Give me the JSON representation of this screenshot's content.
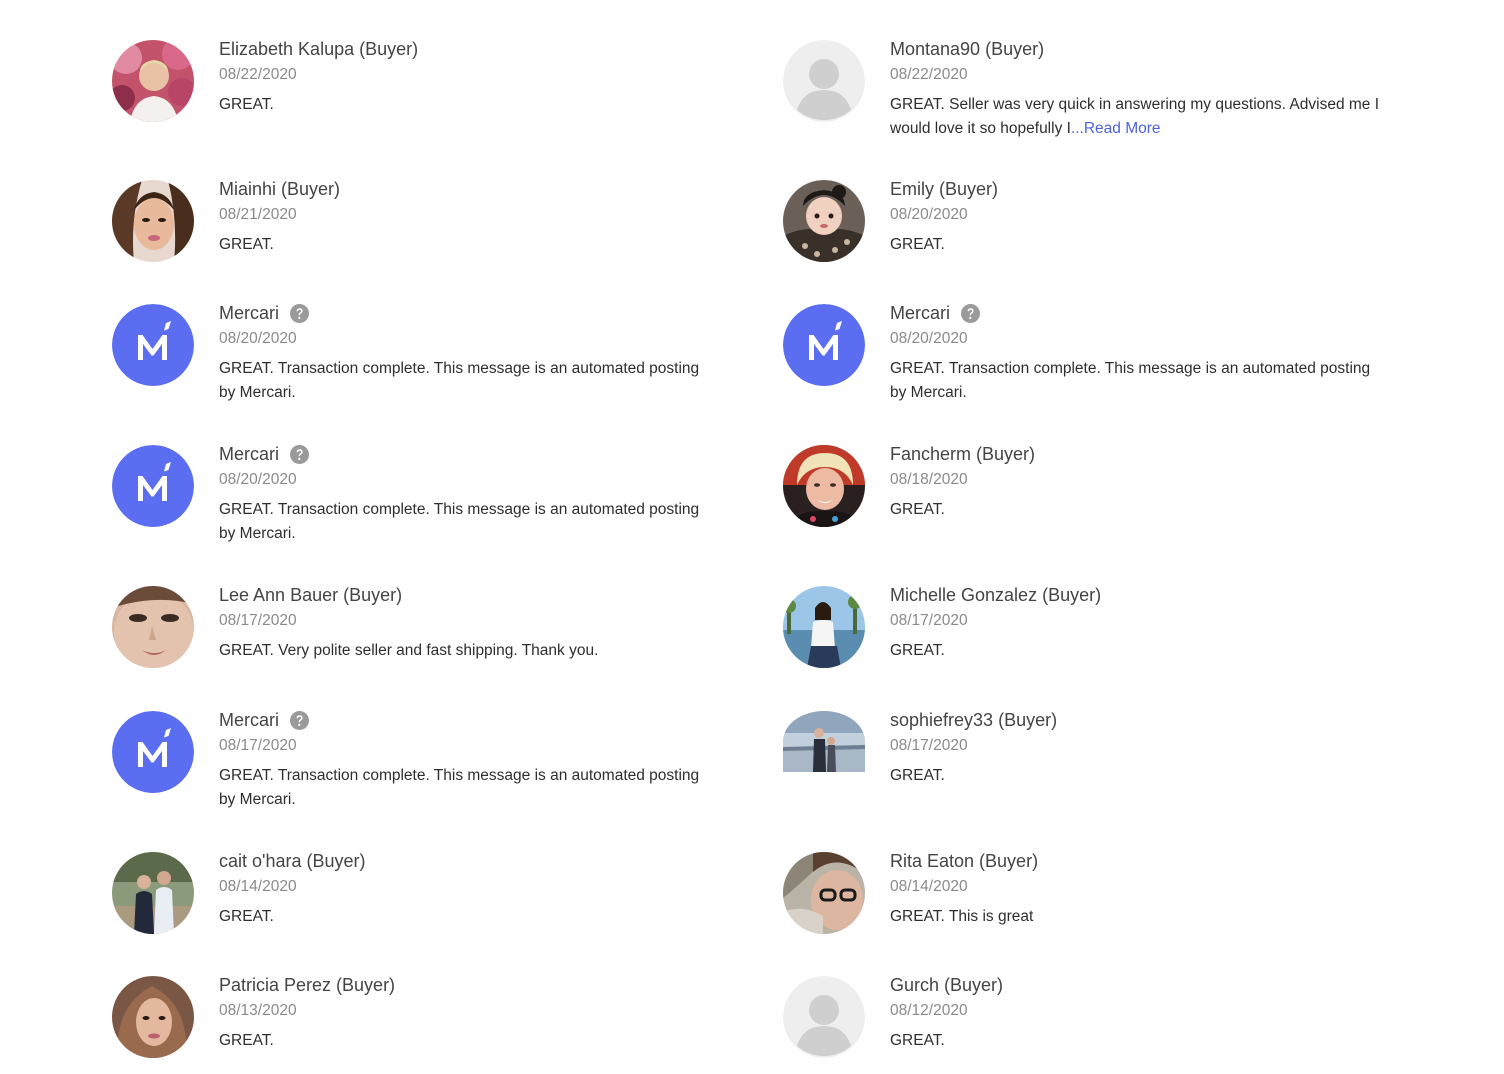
{
  "colors": {
    "mercari_brand": "#5b6df0",
    "link": "#4f63d9",
    "date_gray": "#8a8a8a",
    "placeholder_bg": "#eeeeee",
    "placeholder_fg": "#cfcfcf"
  },
  "reviews": [
    {
      "name": "Elizabeth Kalupa (Buyer)",
      "date": "08/22/2020",
      "text": "GREAT.",
      "avatar": "photo"
    },
    {
      "name": "Montana90 (Buyer)",
      "date": "08/22/2020",
      "text": "GREAT. Seller was very quick in answering my questions. Advised me I would love it so hopefully I",
      "ellipsis": "...",
      "read_more": "Read More",
      "avatar": "person-placeholder-icon"
    },
    {
      "name": "Miainhi (Buyer)",
      "date": "08/21/2020",
      "text": "GREAT.",
      "avatar": "photo"
    },
    {
      "name": "Emily (Buyer)",
      "date": "08/20/2020",
      "text": "GREAT.",
      "avatar": "photo"
    },
    {
      "name": "Mercari",
      "date": "08/20/2020",
      "text": "GREAT. Transaction complete. This message is an automated posting by Mercari.",
      "avatar": "mercari-logo-icon",
      "help_icon": "question-circle-icon"
    },
    {
      "name": "Mercari",
      "date": "08/20/2020",
      "text": "GREAT. Transaction complete. This message is an automated posting by Mercari.",
      "avatar": "mercari-logo-icon",
      "help_icon": "question-circle-icon"
    },
    {
      "name": "Mercari",
      "date": "08/20/2020",
      "text": "GREAT. Transaction complete. This message is an automated posting by Mercari.",
      "avatar": "mercari-logo-icon",
      "help_icon": "question-circle-icon"
    },
    {
      "name": "Fancherm (Buyer)",
      "date": "08/18/2020",
      "text": "GREAT.",
      "avatar": "photo"
    },
    {
      "name": "Lee Ann Bauer (Buyer)",
      "date": "08/17/2020",
      "text": "GREAT. Very polite seller and fast shipping. Thank you.",
      "avatar": "photo"
    },
    {
      "name": "Michelle Gonzalez (Buyer)",
      "date": "08/17/2020",
      "text": "GREAT.",
      "avatar": "photo"
    },
    {
      "name": "Mercari",
      "date": "08/17/2020",
      "text": "GREAT. Transaction complete. This message is an automated posting by Mercari.",
      "avatar": "mercari-logo-icon",
      "help_icon": "question-circle-icon"
    },
    {
      "name": "sophiefrey33 (Buyer)",
      "date": "08/17/2020",
      "text": "GREAT.",
      "avatar": "photo"
    },
    {
      "name": "cait o'hara (Buyer)",
      "date": "08/14/2020",
      "text": "GREAT.",
      "avatar": "photo"
    },
    {
      "name": "Rita Eaton (Buyer)",
      "date": "08/14/2020",
      "text": "GREAT. This is great",
      "avatar": "photo"
    },
    {
      "name": "Patricia Perez (Buyer)",
      "date": "08/13/2020",
      "text": "GREAT.",
      "avatar": "photo"
    },
    {
      "name": "Gurch (Buyer)",
      "date": "08/12/2020",
      "text": "GREAT.",
      "avatar": "person-placeholder-icon"
    }
  ]
}
